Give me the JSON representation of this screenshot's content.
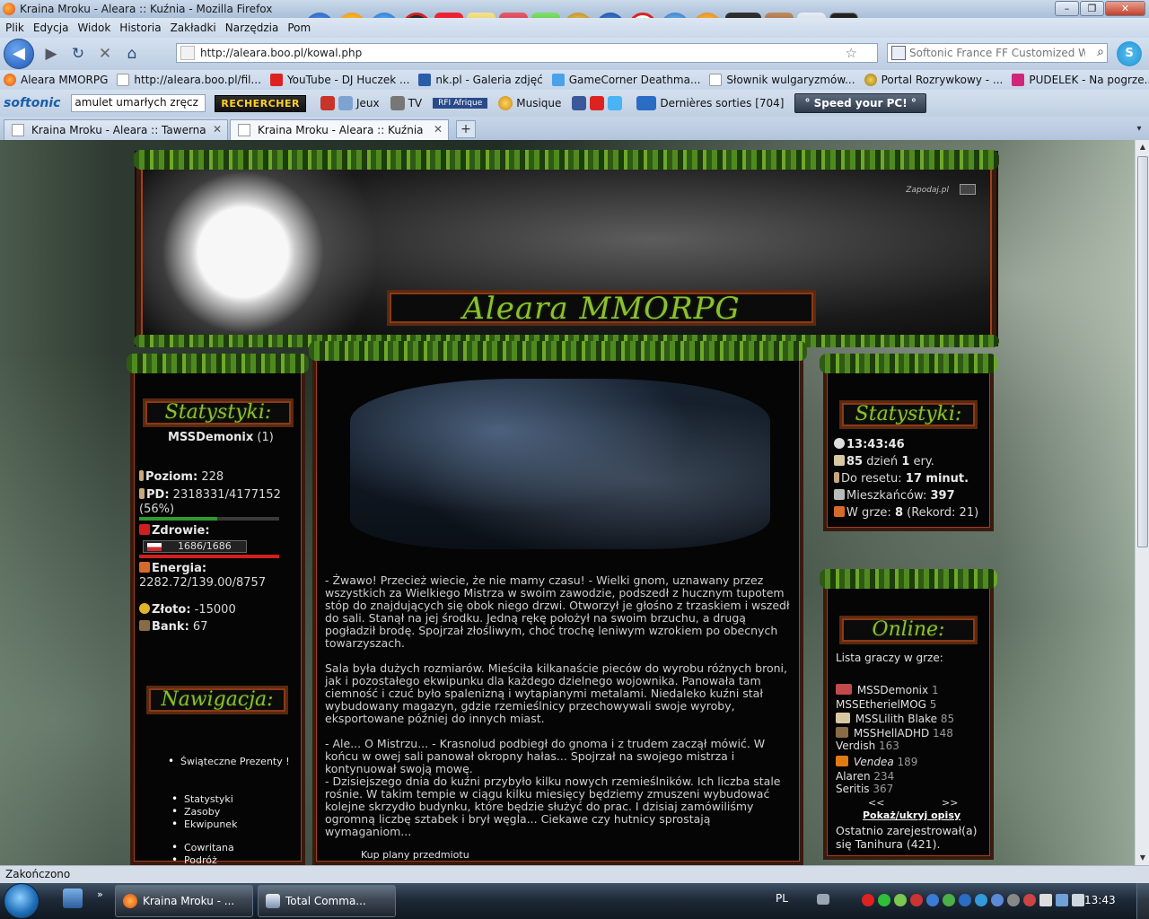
{
  "window": {
    "title": "Kraina Mroku - Aleara :: Kuźnia - Mozilla Firefox"
  },
  "menu": {
    "items": [
      "Plik",
      "Edycja",
      "Widok",
      "Historia",
      "Zakładki",
      "Narzędzia",
      "Pom"
    ]
  },
  "nav": {
    "url": "http://aleara.boo.pl/kowal.php",
    "search_placeholder": "Softonic France FF Customized Web"
  },
  "bookmarks": [
    "Aleara MMORPG",
    "http://aleara.boo.pl/fil...",
    "YouTube - DJ Huczek ...",
    "nk.pl - Galeria zdjęć",
    "GameCorner Deathma...",
    "Słownik wulgaryzmów...",
    "Portal Rozrywkowy - ...",
    "PUDELEK - Na pogrze..."
  ],
  "softonic": {
    "logo": "softonic",
    "search_value": "amulet umarłych zręcz",
    "rechercher": "RECHERCHER",
    "jeux": "Jeux",
    "tv": "TV",
    "radio": "RFI Afrique",
    "musique": "Musique",
    "rss": "Dernières sorties [704]",
    "speed": "° Speed your PC! °"
  },
  "tabs": [
    {
      "label": "Kraina Mroku - Aleara :: Tawerna",
      "active": false
    },
    {
      "label": "Kraina Mroku - Aleara :: Kuźnia",
      "active": true
    }
  ],
  "banner": {
    "title": "Aleara MMORPG",
    "sitelink": "Zapodaj.pl"
  },
  "left_stats": {
    "title": "Statystyki:",
    "player": "MSSDemonix",
    "player_id": "(1)",
    "level_label": "Poziom:",
    "level": "228",
    "pd_label": "PD:",
    "pd": "2318331/4177152",
    "pd_pct": "(56%)",
    "pd_progress": 0.56,
    "health_label": "Zdrowie:",
    "health": "1686/1686",
    "health_progress": 1.0,
    "energy_label": "Energia:",
    "energy": "2282.72/139.00/8757",
    "gold_label": "Złoto:",
    "gold": "-15000",
    "bank_label": "Bank:",
    "bank": "67"
  },
  "navigation": {
    "title": "Nawigacja:",
    "items": [
      "Świąteczne Prezenty !",
      "Statystyki",
      "Zasoby",
      "Ekwipunek",
      "Cowritana",
      "Podróż"
    ]
  },
  "center": {
    "p1": "- Żwawo! Przecież wiecie, że nie mamy czasu! - Wielki gnom, uznawany przez wszystkich za Wielkiego Mistrza w swoim zawodzie, podszedł z hucznym tupotem stóp do znajdujących się obok niego drzwi. Otworzył je głośno z trzaskiem i wszedł do sali. Stanął na jej środku. Jedną rękę położył na swoim brzuchu, a drugą pogładził brodę. Spojrzał złośliwym, choć trochę leniwym wzrokiem po obecnych towarzyszach.",
    "p2": "Sala była dużych rozmiarów. Mieściła kilkanaście pieców do wyrobu różnych broni, jak i pozostałego ekwipunku dla każdego dzielnego wojownika. Panowała tam ciemność i czuć było spalenizną i wytapianymi metalami. Niedaleko kuźni stał wybudowany magazyn, gdzie rzemieślnicy przechowywali swoje wyroby, eksportowane później do innych miast.",
    "p3": "- Ale... O Mistrzu... - Krasnolud podbiegł do gnoma i z trudem zaczął mówić. W końcu w owej sali panował okropny hałas... Spojrzał na swojego mistrza i kontynuował swoją mowę.",
    "p4": "- Dzisiejszego dnia do kuźni przybyło kilku nowych rzemieślników. Ich liczba stale rośnie. W takim tempie w ciągu kilku miesięcy będziemy zmuszeni wybudować kolejne skrzydło budynku, które będzie służyć do prac. I dzisiaj zamówiliśmy ogromną liczbę sztabek i brył węgla... Ciekawe czy hutnicy sprostają wymaganiom...",
    "link1": "Kup plany przedmiotu"
  },
  "right_stats": {
    "title": "Statystyki:",
    "time": "13:43:46",
    "day_num": "85",
    "day_text": "dzień",
    "era_num": "1",
    "era_text": "ery.",
    "reset_label": "Do resetu:",
    "reset_value": "17 minut.",
    "residents_label": "Mieszkańców:",
    "residents": "397",
    "ingame_label": "W grze:",
    "ingame": "8",
    "record": "(Rekord: 21)"
  },
  "online": {
    "title": "Online:",
    "subtitle": "Lista graczy w grze:",
    "players": [
      {
        "name": "MSSDemonix",
        "lvl": "1"
      },
      {
        "name": "MSSEtherielMOG",
        "lvl": "5"
      },
      {
        "name": "MSSLilith Blake",
        "lvl": "85"
      },
      {
        "name": "MSSHellADHD",
        "lvl": "148"
      },
      {
        "name": "Verdish",
        "lvl": "163"
      },
      {
        "name": "Vendea",
        "lvl": "189"
      },
      {
        "name": "Alaren",
        "lvl": "234"
      },
      {
        "name": "Seritis",
        "lvl": "367"
      }
    ],
    "prev": "<<",
    "next": ">>",
    "toggle": "Pokaż/ukryj opisy",
    "last_registered": "Ostatnio zarejestrował(a) się Tanihura (421)."
  },
  "statusbar": {
    "text": "Zakończono"
  },
  "taskbar": {
    "items": [
      "Kraina Mroku - ...",
      "Total Comma..."
    ],
    "lang": "PL",
    "clock": "13:43"
  },
  "colors": {
    "accent_green": "#8dbf2f",
    "frame_brown": "#3b1a0e",
    "hp_red": "#d01f1f",
    "pd_green": "#2f9a2f"
  }
}
